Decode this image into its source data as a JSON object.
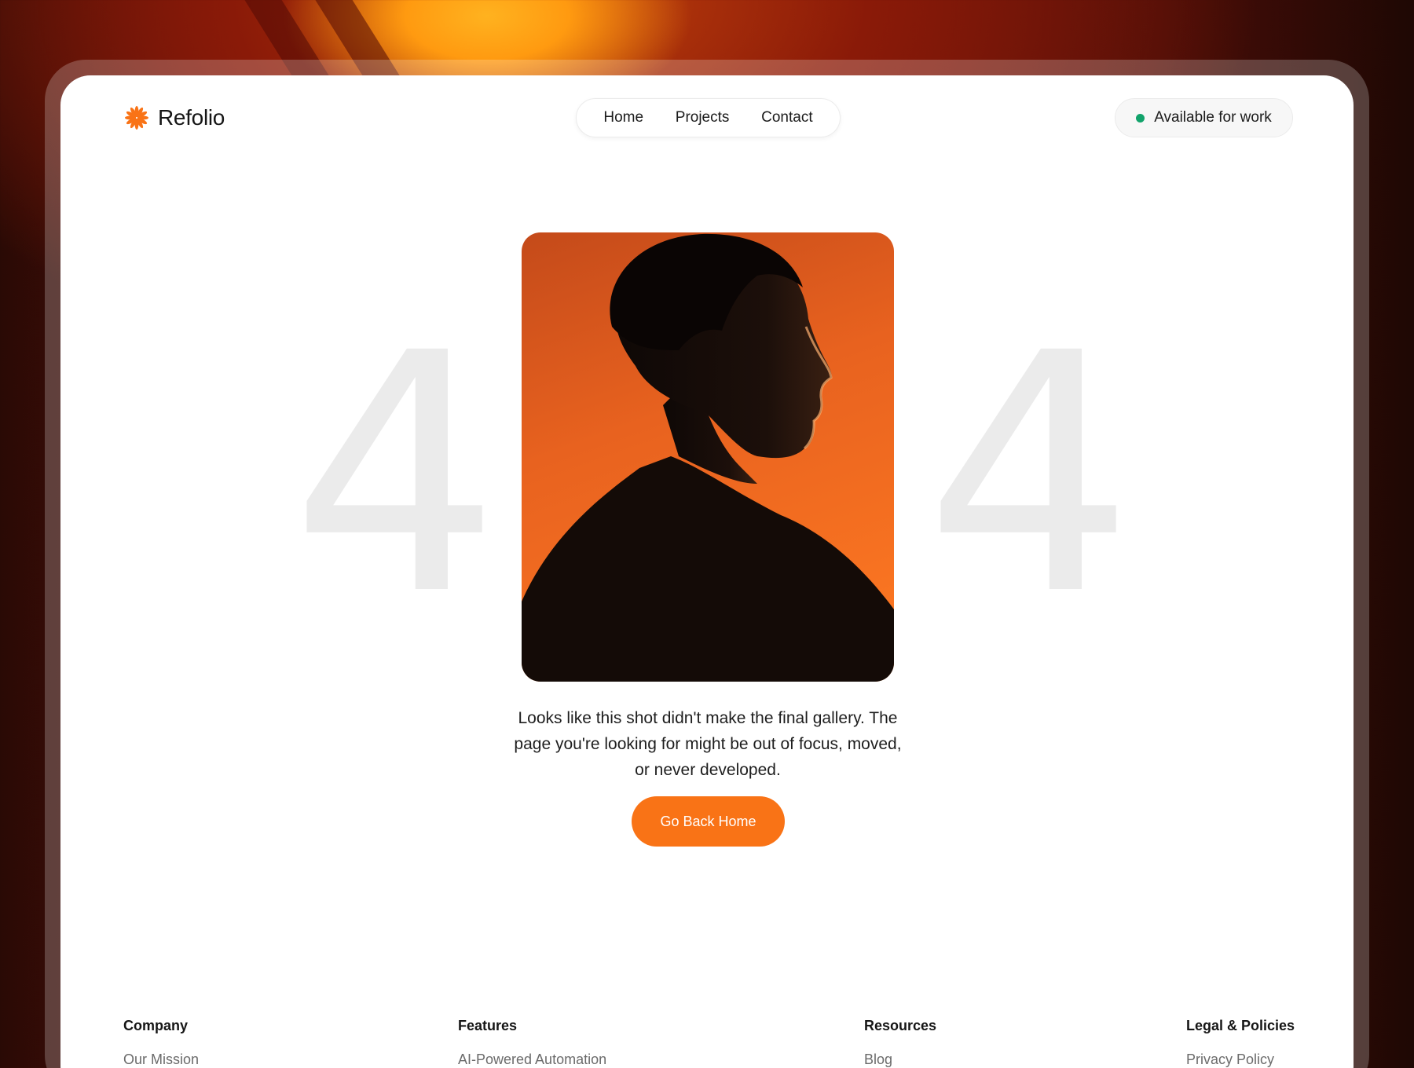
{
  "brand": {
    "name": "Refolio",
    "accent": "#f97316"
  },
  "nav": {
    "items": [
      "Home",
      "Projects",
      "Contact"
    ]
  },
  "status": {
    "label": "Available for work",
    "dot_color": "#12a36b"
  },
  "error": {
    "digit_left": "4",
    "digit_right": "4",
    "message": "Looks like this shot didn't make the final gallery. The page you're looking for might be out of focus, moved, or never developed.",
    "button_label": "Go Back Home"
  },
  "footer": {
    "columns": [
      {
        "heading": "Company",
        "first_link": "Our Mission"
      },
      {
        "heading": "Features",
        "first_link": "AI-Powered Automation"
      },
      {
        "heading": "Resources",
        "first_link": "Blog"
      },
      {
        "heading": "Legal & Policies",
        "first_link": "Privacy Policy"
      }
    ]
  }
}
